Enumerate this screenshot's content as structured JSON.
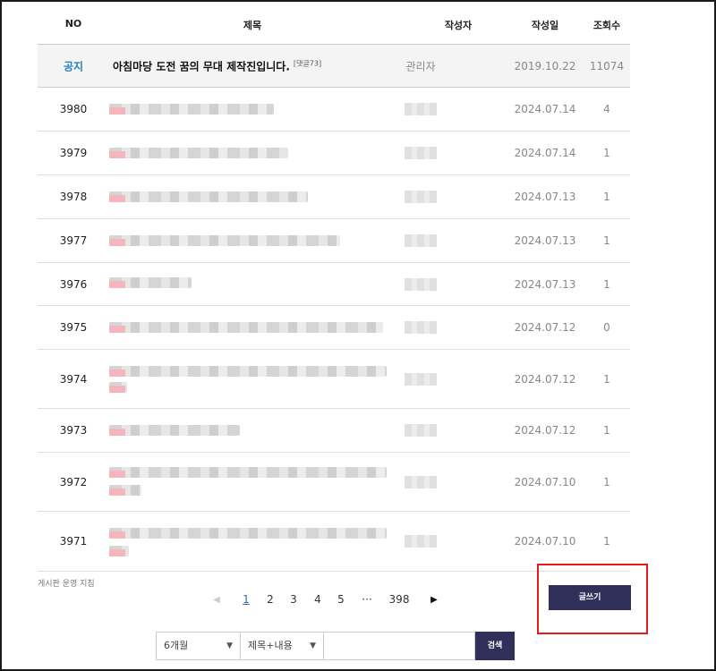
{
  "columns": {
    "no": "NO",
    "title": "제목",
    "author": "작성자",
    "date": "작성일",
    "views": "조회수"
  },
  "notice": {
    "label": "공지",
    "title": "아침마당 도전 꿈의 무대 제작진입니다.",
    "comments": "[댓글73]",
    "author": "관리자",
    "date": "2019.10.22",
    "views": "11074"
  },
  "posts": [
    {
      "no": "3980",
      "date": "2024.07.14",
      "views": "4"
    },
    {
      "no": "3979",
      "date": "2024.07.14",
      "views": "1"
    },
    {
      "no": "3978",
      "date": "2024.07.13",
      "views": "1"
    },
    {
      "no": "3977",
      "date": "2024.07.13",
      "views": "1"
    },
    {
      "no": "3976",
      "date": "2024.07.13",
      "views": "1"
    },
    {
      "no": "3975",
      "date": "2024.07.12",
      "views": "0"
    },
    {
      "no": "3974",
      "date": "2024.07.12",
      "views": "1"
    },
    {
      "no": "3973",
      "date": "2024.07.12",
      "views": "1"
    },
    {
      "no": "3972",
      "date": "2024.07.10",
      "views": "1"
    },
    {
      "no": "3971",
      "date": "2024.07.10",
      "views": "1"
    }
  ],
  "policy_link": "게시판 운영 지침",
  "pagination": {
    "prev_icon": "caret-left-icon",
    "pages": [
      "1",
      "2",
      "3",
      "4",
      "5"
    ],
    "ellipsis": "···",
    "last": "398",
    "next_icon": "caret-right-icon",
    "current": "1"
  },
  "write_button": "글쓰기",
  "search": {
    "period": "6개월",
    "field": "제목+내용",
    "query": "",
    "button": "검색",
    "chevron_icon": "chevron-down-icon"
  },
  "highlight_color": "#e21b1b",
  "accent_color": "#30305a"
}
